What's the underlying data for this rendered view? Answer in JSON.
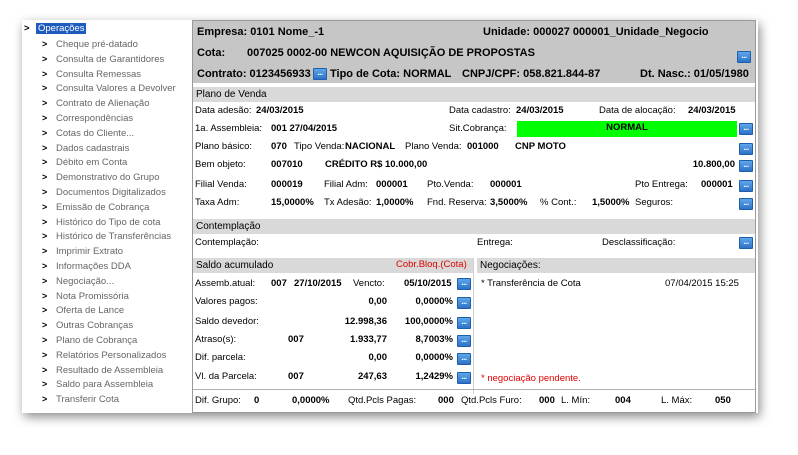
{
  "menu": {
    "root": "Operações",
    "items": [
      "Cheque pré-datado",
      "Consulta de Garantidores",
      "Consulta Remessas",
      "Consulta Valores a Devolver",
      "Contrato de Alienação",
      "Correspondências",
      "Cotas do Cliente...",
      "Dados cadastrais",
      "Débito em Conta",
      "Demonstrativo do Grupo",
      "Documentos Digitalizados",
      "Emissão de Cobrança",
      "Histórico do Tipo de cota",
      "Histórico de Transferências",
      "Imprimir Extrato",
      "Informações DDA",
      "Negociação...",
      "Nota Promissória",
      "Oferta de Lance",
      "Outras Cobranças",
      "Plano de Cobrança",
      "Relatórios Personalizados",
      "Resultado de Assembleia",
      "Saldo para Assembleia",
      "Transferir Cota"
    ]
  },
  "header": {
    "empresa": "Empresa: 0101 Nome_-1",
    "unidade": "Unidade: 000027 000001_Unidade_Negocio",
    "cota_label": "Cota:",
    "cota_value": "007025  0002-00 NEWCON AQUISIÇÃO DE PROPOSTAS",
    "contrato": "Contrato: 0123456933",
    "tipo_cota": "Tipo de Cota: NORMAL",
    "cnpj": "CNPJ/CPF: 058.821.844-87",
    "dt_nasc": "Dt. Nasc.: 01/05/1980",
    "btn": "..."
  },
  "plano": {
    "title": "Plano de Venda",
    "data_adesao_label": "Data adesão:",
    "data_adesao": "24/03/2015",
    "data_cadastro_label": "Data cadastro:",
    "data_cadastro": "24/03/2015",
    "data_alocacao_label": "Data de alocação:",
    "data_alocacao": "24/03/2015",
    "assembleia_label": "1a. Assembleia:",
    "assembleia": "001  27/04/2015",
    "sit_cobranca_label": "Sit.Cobrança:",
    "sit_cobranca": "NORMAL",
    "plano_basico_label": "Plano básico:",
    "plano_basico": "070",
    "tipo_venda_label": "Tipo Venda:",
    "tipo_venda": "NACIONAL",
    "plano_venda_label": "Plano Venda:",
    "plano_venda": "001000",
    "plano_venda_name": "CNP MOTO",
    "bem_objeto_label": "Bem objeto:",
    "bem_objeto": "007010",
    "bem_objeto_desc": "CRÉDITO R$ 10.000,00",
    "bem_valor": "10.800,00",
    "filial_venda_label": "Filial Venda:",
    "filial_venda": "000019",
    "filial_adm_label": "Filial Adm:",
    "filial_adm": "000001",
    "pto_venda_label": "Pto.Venda:",
    "pto_venda": "000001",
    "pto_entrega_label": "Pto Entrega:",
    "pto_entrega": "000001",
    "taxa_adm_label": "Taxa Adm:",
    "taxa_adm": "15,0000%",
    "tx_adesao_label": "Tx Adesão:",
    "tx_adesao": "1,0000%",
    "fnd_reserva_label": "Fnd. Reserva:",
    "fnd_reserva": "3,5000%",
    "pct_cont_label": "% Cont.:",
    "pct_cont": "1,5000%",
    "seguros_label": "Seguros:"
  },
  "contemplacao": {
    "title": "Contemplação",
    "contemplacao_label": "Contemplação:",
    "entrega_label": "Entrega:",
    "desclassificacao_label": "Desclassificação:"
  },
  "saldo": {
    "title": "Saldo acumulado",
    "cobr_bloq": "Cobr.Bloq.(Cota)",
    "assemb_label": "Assemb.atual:",
    "assemb_num": "007",
    "assemb_date": "27/10/2015",
    "vencto_label": "Vencto:",
    "vencto": "05/10/2015",
    "rows": [
      {
        "label": "Valores pagos:",
        "num": "",
        "value": "0,00",
        "pct": "0,0000%"
      },
      {
        "label": "Saldo devedor:",
        "num": "",
        "value": "12.998,36",
        "pct": "100,0000%"
      },
      {
        "label": "Atraso(s):",
        "num": "007",
        "value": "1.933,77",
        "pct": "8,7003%"
      },
      {
        "label": "Dif. parcela:",
        "num": "",
        "value": "0,00",
        "pct": "0,0000%"
      },
      {
        "label": "Vl. da Parcela:",
        "num": "007",
        "value": "247,63",
        "pct": "1,2429%"
      }
    ]
  },
  "negociacoes": {
    "title": "Negociações:",
    "item_label": "* Transferência de Cota",
    "item_date": "07/04/2015 15:25",
    "pending": "* negociação pendente."
  },
  "footer": {
    "dif_grupo_label": "Dif. Grupo:",
    "dif_grupo_num": "0",
    "dif_grupo_pct": "0,0000%",
    "qtd_pagas_label": "Qtd.Pcls Pagas:",
    "qtd_pagas": "000",
    "qtd_furo_label": "Qtd.Pcls Furo:",
    "qtd_furo": "000",
    "l_min_label": "L. Mín:",
    "l_min": "004",
    "l_max_label": "L. Máx:",
    "l_max": "050"
  }
}
